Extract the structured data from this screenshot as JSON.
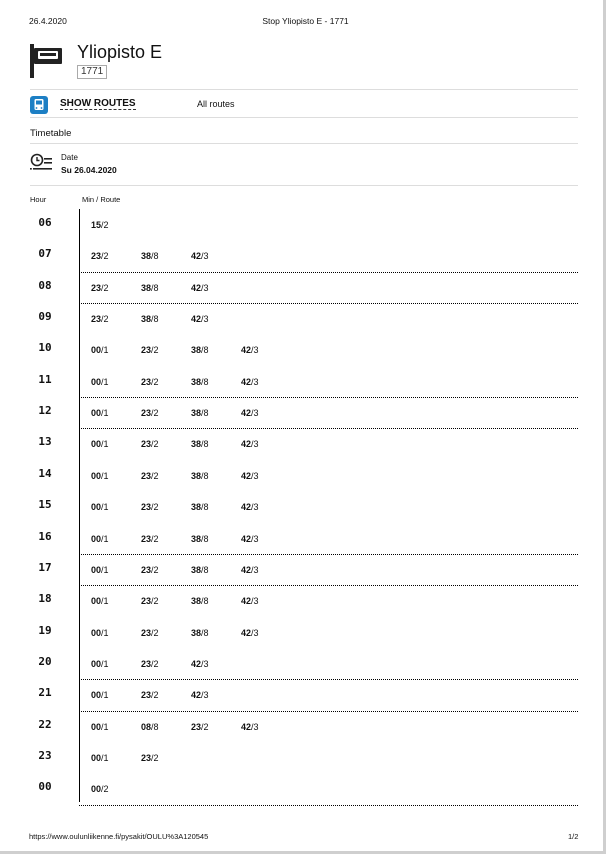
{
  "print_header": {
    "date": "26.4.2020",
    "title": "Stop Yliopisto E - 1771"
  },
  "stop": {
    "name": "Yliopisto E",
    "code": "1771"
  },
  "routes_bar": {
    "show_routes": "SHOW ROUTES",
    "all_routes": "All routes"
  },
  "timetable": {
    "label": "Timetable",
    "date_label": "Date",
    "date_value": "Su 26.04.2020",
    "col_hour": "Hour",
    "col_min_route": "Min / Route",
    "rows": [
      {
        "hour": "06",
        "deps": [
          [
            "15",
            "/2"
          ]
        ],
        "sep": false
      },
      {
        "hour": "07",
        "deps": [
          [
            "23",
            "/2"
          ],
          [
            "38",
            "/8"
          ],
          [
            "42",
            "/3"
          ]
        ],
        "sep": true
      },
      {
        "hour": "08",
        "deps": [
          [
            "23",
            "/2"
          ],
          [
            "38",
            "/8"
          ],
          [
            "42",
            "/3"
          ]
        ],
        "sep": true
      },
      {
        "hour": "09",
        "deps": [
          [
            "23",
            "/2"
          ],
          [
            "38",
            "/8"
          ],
          [
            "42",
            "/3"
          ]
        ],
        "sep": false
      },
      {
        "hour": "10",
        "deps": [
          [
            "00",
            "/1"
          ],
          [
            "23",
            "/2"
          ],
          [
            "38",
            "/8"
          ],
          [
            "42",
            "/3"
          ]
        ],
        "sep": false
      },
      {
        "hour": "11",
        "deps": [
          [
            "00",
            "/1"
          ],
          [
            "23",
            "/2"
          ],
          [
            "38",
            "/8"
          ],
          [
            "42",
            "/3"
          ]
        ],
        "sep": true
      },
      {
        "hour": "12",
        "deps": [
          [
            "00",
            "/1"
          ],
          [
            "23",
            "/2"
          ],
          [
            "38",
            "/8"
          ],
          [
            "42",
            "/3"
          ]
        ],
        "sep": true
      },
      {
        "hour": "13",
        "deps": [
          [
            "00",
            "/1"
          ],
          [
            "23",
            "/2"
          ],
          [
            "38",
            "/8"
          ],
          [
            "42",
            "/3"
          ]
        ],
        "sep": false
      },
      {
        "hour": "14",
        "deps": [
          [
            "00",
            "/1"
          ],
          [
            "23",
            "/2"
          ],
          [
            "38",
            "/8"
          ],
          [
            "42",
            "/3"
          ]
        ],
        "sep": false
      },
      {
        "hour": "15",
        "deps": [
          [
            "00",
            "/1"
          ],
          [
            "23",
            "/2"
          ],
          [
            "38",
            "/8"
          ],
          [
            "42",
            "/3"
          ]
        ],
        "sep": false
      },
      {
        "hour": "16",
        "deps": [
          [
            "00",
            "/1"
          ],
          [
            "23",
            "/2"
          ],
          [
            "38",
            "/8"
          ],
          [
            "42",
            "/3"
          ]
        ],
        "sep": true
      },
      {
        "hour": "17",
        "deps": [
          [
            "00",
            "/1"
          ],
          [
            "23",
            "/2"
          ],
          [
            "38",
            "/8"
          ],
          [
            "42",
            "/3"
          ]
        ],
        "sep": true
      },
      {
        "hour": "18",
        "deps": [
          [
            "00",
            "/1"
          ],
          [
            "23",
            "/2"
          ],
          [
            "38",
            "/8"
          ],
          [
            "42",
            "/3"
          ]
        ],
        "sep": false
      },
      {
        "hour": "19",
        "deps": [
          [
            "00",
            "/1"
          ],
          [
            "23",
            "/2"
          ],
          [
            "38",
            "/8"
          ],
          [
            "42",
            "/3"
          ]
        ],
        "sep": false
      },
      {
        "hour": "20",
        "deps": [
          [
            "00",
            "/1"
          ],
          [
            "23",
            "/2"
          ],
          [
            "42",
            "/3"
          ]
        ],
        "sep": true
      },
      {
        "hour": "21",
        "deps": [
          [
            "00",
            "/1"
          ],
          [
            "23",
            "/2"
          ],
          [
            "42",
            "/3"
          ]
        ],
        "sep": true
      },
      {
        "hour": "22",
        "deps": [
          [
            "00",
            "/1"
          ],
          [
            "08",
            "/8"
          ],
          [
            "23",
            "/2"
          ],
          [
            "42",
            "/3"
          ]
        ],
        "sep": false
      },
      {
        "hour": "23",
        "deps": [
          [
            "00",
            "/1"
          ],
          [
            "23",
            "/2"
          ]
        ],
        "sep": false
      },
      {
        "hour": "00",
        "deps": [
          [
            "00",
            "/2"
          ]
        ],
        "sep": true
      }
    ]
  },
  "footer": {
    "url": "https://www.oulunliikenne.fi/pysakit/OULU%3A120545",
    "page": "1/2"
  },
  "colors": {
    "accent": "#1d7fc4"
  }
}
